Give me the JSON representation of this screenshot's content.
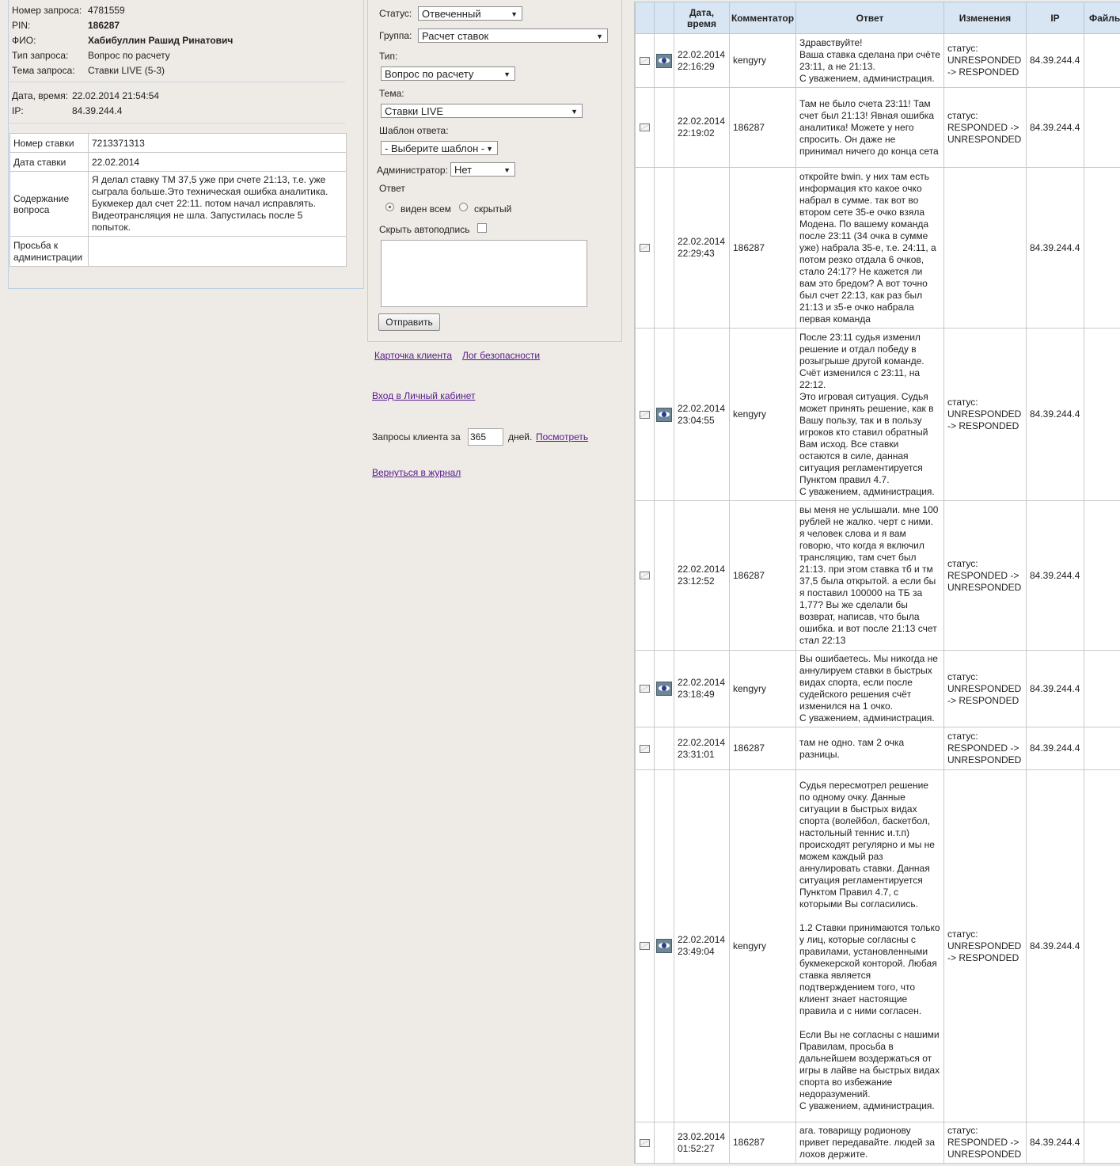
{
  "request": {
    "number_label": "Номер запроса:",
    "number": "4781559",
    "pin_label": "PIN:",
    "pin": "186287",
    "fio_label": "ФИО:",
    "fio": "Хабибуллин Рашид Ринатович",
    "type_label": "Тип запроса:",
    "type": "Вопрос по расчету",
    "topic_label": "Тема запроса:",
    "topic": "Ставки LIVE (5-3)",
    "datetime_label": "Дата, время:",
    "datetime": "22.02.2014 21:54:54",
    "ip_label": "IP:",
    "ip": "84.39.244.4"
  },
  "bet": {
    "number_label": "Номер ставки",
    "number": "7213371313",
    "date_label": "Дата ставки",
    "date": "22.02.2014",
    "content_label": "Содержание вопроса",
    "content": "Я делал ставку ТМ 37,5 уже при счете 21:13, т.е. уже сыграла больше.Это техническая ошибка аналитика. Букмекер дал счет 22:11. потом начал исправлять. Видеотрансляция не шла. Запустилась после 5 попыток.",
    "request_label": "Просьба к администрации",
    "request": ""
  },
  "form": {
    "status_label": "Статус:",
    "status": "Отвеченный",
    "group_label": "Группа:",
    "group": "Расчет ставок",
    "type_label": "Тип:",
    "type": "Вопрос по расчету",
    "topic_label": "Тема:",
    "topic": "Ставки LIVE",
    "template_label": "Шаблон ответа:",
    "template": "- Выберите шаблон -",
    "admin_label": "Администратор:",
    "admin": "Нет",
    "answer_label": "Ответ",
    "visible_all": "виден всем",
    "hidden": "скрытый",
    "hide_signature": "Скрыть автоподпись",
    "send": "Отправить"
  },
  "links": {
    "client_card": "Карточка клиента",
    "security_log": "Лог безопасности",
    "cabinet": "Вход в Личный кабинет",
    "requests_prefix": "Запросы клиента за",
    "days_value": "365",
    "days_suffix": "дней.",
    "view": "Посмотреть",
    "back": "Вернуться в журнал"
  },
  "history": {
    "headers": [
      "",
      "",
      "Дата, время",
      "Комментатор",
      "Ответ",
      "Изменения",
      "IP",
      "Файлы"
    ],
    "rows": [
      {
        "date": "22.02.2014 22:16:29",
        "author": "kengyry",
        "eye": true,
        "answer": "Здравствуйте!\nВаша ставка сделана при счёте 23:11, а не 21:13.\nС уважением, администрация.",
        "changes": "статус: UNRESPONDED -> RESPONDED",
        "ip": "84.39.244.4"
      },
      {
        "date": "22.02.2014 22:19:02",
        "author": "186287",
        "eye": false,
        "answer": "Там не было счета 23:11! Там счет был 21:13! Явная ошибка аналитика! Можете у него спросить. Он даже не принимал ничего до конца сета",
        "changes": "статус: RESPONDED -> UNRESPONDED",
        "ip": "84.39.244.4"
      },
      {
        "date": "22.02.2014 22:29:43",
        "author": "186287",
        "eye": false,
        "answer": "откройте bwin. у них там есть информация кто какое очко набрал в сумме. так вот во втором сете 35-е очко взяла Модена. По вашему команда после 23:11 (34 очка в сумме уже) набрала 35-е, т.е. 24:11, а потом резко отдала 6 очков, стало 24:17? Не кажется ли вам это бредом? А вот точно был счет 22:13, как раз был 21:13 и з5-е очко набрала первая команда",
        "changes": "",
        "ip": "84.39.244.4"
      },
      {
        "date": "22.02.2014 23:04:55",
        "author": "kengyry",
        "eye": true,
        "answer": "После 23:11 судья изменил решение и отдал победу в розыгрыше другой команде. Счёт изменился с 23:11, на 22:12.\nЭто игровая ситуация. Судья может принять решение, как в Вашу пользу, так и в пользу игроков кто ставил обратный Вам исход. Все ставки остаются в силе, данная ситуация регламентируется Пунктом правил 4.7.\nС уважением, администрация.",
        "changes": "статус: UNRESPONDED -> RESPONDED",
        "ip": "84.39.244.4"
      },
      {
        "date": "22.02.2014 23:12:52",
        "author": "186287",
        "eye": false,
        "answer": "вы меня не услышали. мне 100 рублей не жалко. черт с ними. я человек слова и я вам говорю, что когда я включил трансляцию, там счет был 21:13. при этом ставка тб и тм 37,5 была открытой. а если бы я поставил 100000 на ТБ за 1,77? Вы же сделали бы возврат, написав, что была ошибка. и вот после 21:13 счет стал 22:13",
        "changes": "статус: RESPONDED -> UNRESPONDED",
        "ip": "84.39.244.4"
      },
      {
        "date": "22.02.2014 23:18:49",
        "author": "kengyry",
        "eye": true,
        "answer": "Вы ошибаетесь. Мы никогда не аннулируем ставки в быстрых видах спорта, если после судейского решения счёт изменился на 1 очко.\nС уважением, администрация.",
        "changes": "статус: UNRESPONDED -> RESPONDED",
        "ip": "84.39.244.4"
      },
      {
        "date": "22.02.2014 23:31:01",
        "author": "186287",
        "eye": false,
        "answer": "там не одно. там 2 очка разницы.",
        "changes": "статус: RESPONDED -> UNRESPONDED",
        "ip": "84.39.244.4"
      },
      {
        "date": "22.02.2014 23:49:04",
        "author": "kengyry",
        "eye": true,
        "answer": "Судья пересмотрел решение по одному очку. Данные ситуации в быстрых видах спорта (волейбол, баскетбол, настольный теннис и.т.п) происходят регулярно и мы не можем каждый раз аннулировать ставки. Данная ситуация регламентируется Пунктом Правил 4.7, с которыми Вы согласились.\n\n1.2 Ставки принимаются только у лиц, которые согласны с правилами, установленными букмекерской конторой. Любая ставка является подтверждением того, что клиент знает настоящие правила и с ними согласен.\n\nЕсли Вы не согласны с нашими Правилам, просьба в дальнейшем воздержаться от игры в лайве на быстрых видах спорта во избежание недоразумений.\nС уважением, администрация.",
        "changes": "статус: UNRESPONDED -> RESPONDED",
        "ip": "84.39.244.4"
      },
      {
        "date": "23.02.2014 01:52:27",
        "author": "186287",
        "eye": false,
        "answer": "ага. товарищу родионову привет передавайте. людей за лохов держите.",
        "changes": "статус: RESPONDED -> UNRESPONDED",
        "ip": "84.39.244.4"
      }
    ]
  }
}
